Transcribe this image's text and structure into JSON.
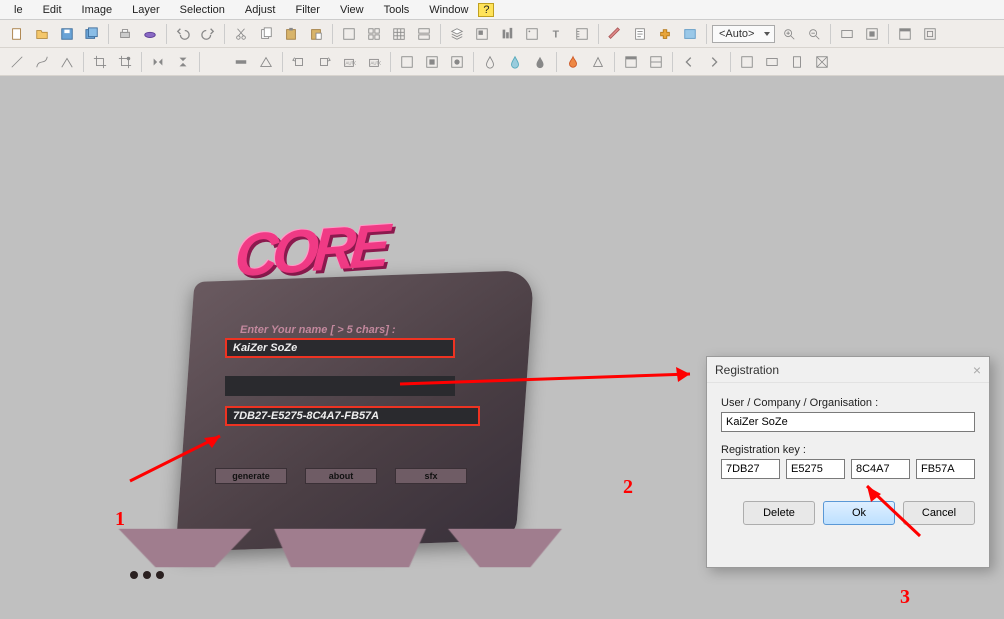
{
  "menubar": {
    "items": [
      "le",
      "Edit",
      "Image",
      "Layer",
      "Selection",
      "Adjust",
      "Filter",
      "View",
      "Tools",
      "Window"
    ],
    "help": "?"
  },
  "toolbar": {
    "auto_label": "<Auto>"
  },
  "keygen": {
    "logo_text": "CORE",
    "prompt": "Enter Your name  [ > 5 chars] :",
    "name_value": "KaiZer SoZe",
    "key_value": "7DB27-E5275-8C4A7-FB57A",
    "buttons": {
      "generate": "generate",
      "about": "about",
      "sfx": "sfx"
    }
  },
  "dialog": {
    "title": "Registration",
    "user_label": "User / Company / Organisation :",
    "user_value": "KaiZer SoZe",
    "key_label": "Registration key :",
    "key_parts": [
      "7DB27",
      "E5275",
      "8C4A7",
      "FB57A"
    ],
    "buttons": {
      "delete": "Delete",
      "ok": "Ok",
      "cancel": "Cancel"
    }
  },
  "annotations": {
    "n1": "1",
    "n2": "2",
    "n3": "3"
  }
}
